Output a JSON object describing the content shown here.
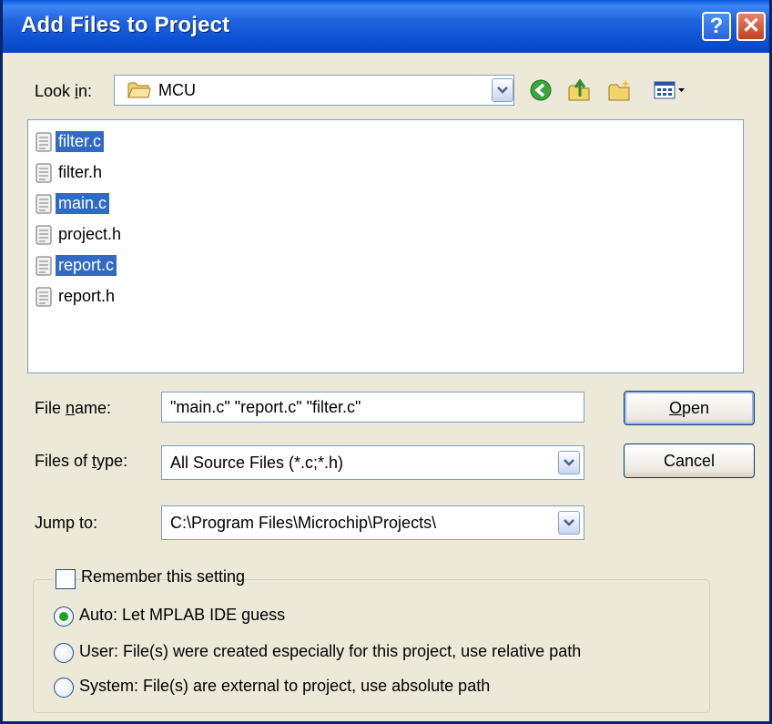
{
  "window": {
    "title": "Add Files to Project",
    "help_glyph": "?",
    "close_glyph": "✕"
  },
  "lookin": {
    "label_pre": "Look ",
    "label_accel": "i",
    "label_post": "n:",
    "value": "MCU",
    "folder_icon": "folder-icon"
  },
  "toolbar": {
    "icons": [
      "back-icon",
      "up-folder-icon",
      "new-folder-icon",
      "view-menu-icon"
    ]
  },
  "files": [
    {
      "name": "filter.c",
      "selected": true
    },
    {
      "name": "filter.h",
      "selected": false
    },
    {
      "name": "main.c",
      "selected": true
    },
    {
      "name": "project.h",
      "selected": false
    },
    {
      "name": "report.c",
      "selected": true
    },
    {
      "name": "report.h",
      "selected": false
    }
  ],
  "filename": {
    "label_pre": "File ",
    "label_accel": "n",
    "label_post": "ame:",
    "value": "\"main.c\" \"report.c\" \"filter.c\""
  },
  "filetype": {
    "label_pre": "Files of ",
    "label_accel": "t",
    "label_post": "ype:",
    "value": "All Source Files (*.c;*.h)"
  },
  "jumpto": {
    "label": "Jump to:",
    "value": "C:\\Program Files\\Microchip\\Projects\\"
  },
  "buttons": {
    "open_accel": "O",
    "open_rest": "pen",
    "cancel": "Cancel"
  },
  "setting": {
    "remember_label": "Remember this setting",
    "remember_checked": false,
    "options": [
      {
        "label": "Auto: Let MPLAB IDE guess",
        "checked": true
      },
      {
        "label": "User: File(s) were created especially for this project, use relative path",
        "checked": false
      },
      {
        "label": "System: File(s) are external to project, use absolute path",
        "checked": false
      }
    ]
  },
  "colors": {
    "titlebar": "#0a4fd0",
    "selection": "#316ac5",
    "dialog_bg": "#ece9d8"
  }
}
